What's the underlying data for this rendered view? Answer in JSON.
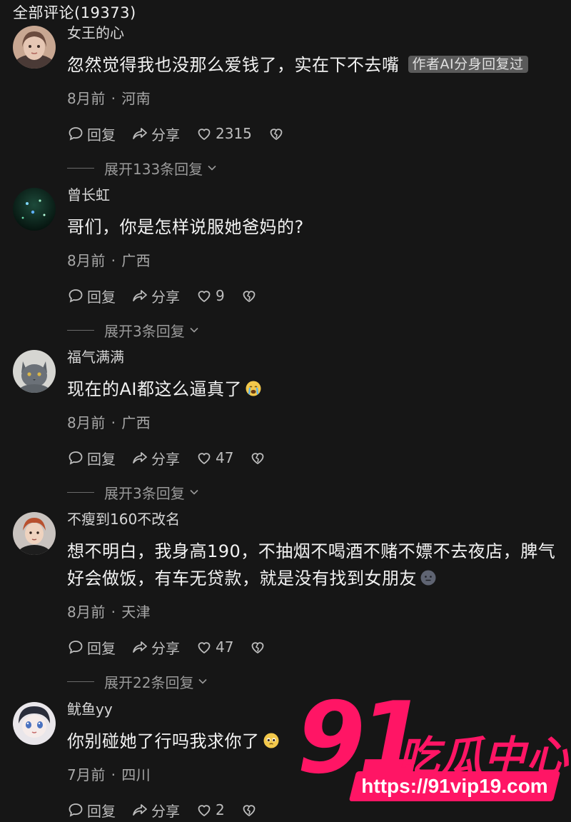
{
  "header": {
    "title": "全部评论(19373)"
  },
  "labels": {
    "reply": "回复",
    "share": "分享"
  },
  "comments": [
    {
      "username": "女王的心",
      "text": "忽然觉得我也没那么爱钱了，实在下不去嘴",
      "badge": "作者AI分身回复过",
      "time": "8月前",
      "location": "河南",
      "likes": "2315",
      "expand": "展开133条回复",
      "avatar_icon": "avatar-girl-icon"
    },
    {
      "username": "曾长虹",
      "text": "哥们，你是怎样说服她爸妈的?",
      "time": "8月前",
      "location": "广西",
      "likes": "9",
      "expand": "展开3条回复",
      "avatar_icon": "avatar-night-lights-icon"
    },
    {
      "username": "福气满满",
      "text": "现在的AI都这么逼真了",
      "emoji": "crying-emoji-icon",
      "time": "8月前",
      "location": "广西",
      "likes": "47",
      "expand": "展开3条回复",
      "avatar_icon": "avatar-cat-icon"
    },
    {
      "username": "不瘦到160不改名",
      "text": "想不明白，我身高190，不抽烟不喝酒不赌不嫖不去夜店，脾气好会做饭，有车无贷款，就是没有找到女朋友",
      "emoji": "speechless-emoji-icon",
      "time": "8月前",
      "location": "天津",
      "likes": "47",
      "expand": "展开22条回复",
      "avatar_icon": "avatar-man-icon"
    },
    {
      "username": "鱿鱼yy",
      "text": "你别碰她了行吗我求你了",
      "emoji": "pleading-emoji-icon",
      "time": "7月前",
      "location": "四川",
      "likes": "2",
      "avatar_icon": "avatar-anime-icon"
    }
  ],
  "watermark": {
    "number": "91",
    "name": "吃瓜中心",
    "url": "https://91vip19.com",
    "color": "#ff1565"
  }
}
